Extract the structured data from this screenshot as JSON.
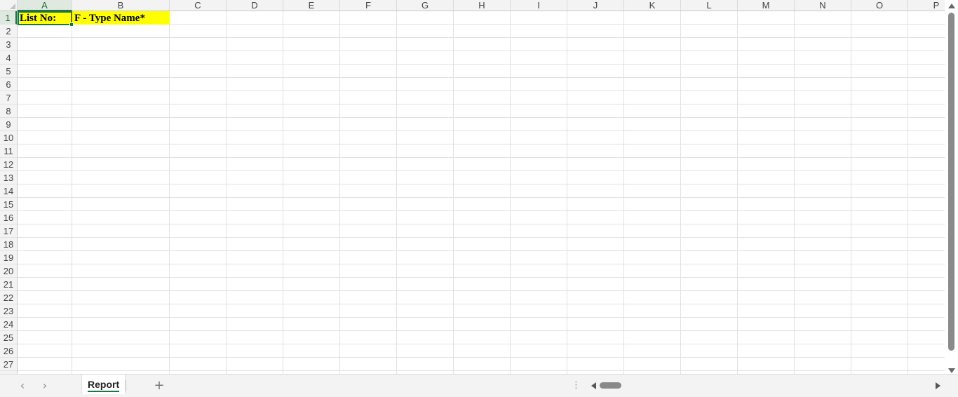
{
  "sheet": {
    "columns": [
      "A",
      "B",
      "C",
      "D",
      "E",
      "F",
      "G",
      "H",
      "I",
      "J",
      "K",
      "L",
      "M",
      "N",
      "O",
      "P"
    ],
    "rows": [
      "1",
      "2",
      "3",
      "4",
      "5",
      "6",
      "7",
      "8",
      "9",
      "10",
      "11",
      "12",
      "13",
      "14",
      "15",
      "16",
      "17",
      "18",
      "19",
      "20",
      "21",
      "22",
      "23",
      "24",
      "25",
      "26",
      "27"
    ],
    "selected_cell": "A1",
    "cells": {
      "a1": "List No:",
      "b1": "F -   Type Name*"
    },
    "highlight_color": "#ffff00",
    "accent_color": "#217346"
  },
  "tabs": {
    "active": "Report",
    "add_label": "+"
  },
  "nav": {
    "prev": "‹",
    "next": "›",
    "dots": "⋮"
  }
}
